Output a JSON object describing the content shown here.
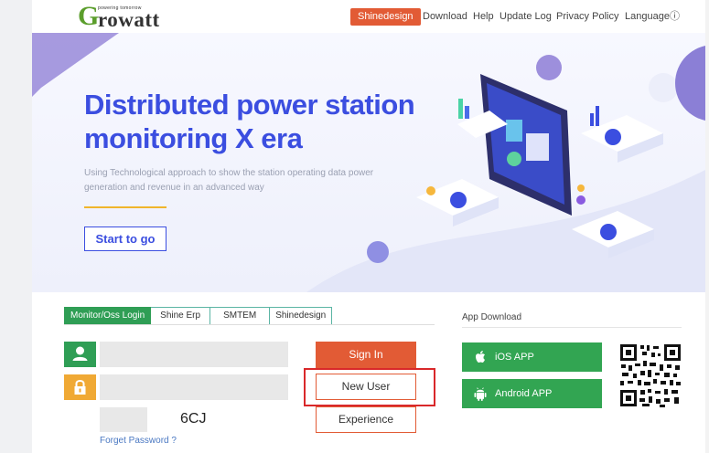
{
  "header": {
    "logo_small": "powering tomorrow",
    "logo_initial": "G",
    "logo_rest": "rowatt",
    "badge": "Shinedesign",
    "links": [
      "Download",
      "Help",
      "Update Log",
      "Privacy Policy",
      "Languageⓘ"
    ]
  },
  "hero": {
    "title": "Distributed power station monitoring X era",
    "subtitle": "Using Technological approach to show the station operating data power generation and revenue in an advanced way",
    "cta": "Start to go"
  },
  "login": {
    "tabs": [
      "Monitor/Oss Login",
      "Shine Erp",
      "SMTEM",
      "Shinedesign"
    ],
    "active_tab": 0,
    "username": "",
    "password": "",
    "captcha_input": "",
    "captcha_code": "6CJ",
    "forget": "Forget Password ?",
    "sign_in": "Sign In",
    "new_user": "New User",
    "experience": "Experience"
  },
  "app": {
    "title": "App Download",
    "ios": "iOS APP",
    "android": "Android APP"
  },
  "colors": {
    "brand_green": "#2f9e55",
    "accent_orange": "#e25b35",
    "hero_blue": "#3b4ee0",
    "lock_yellow": "#f0a934",
    "highlight_red": "#d9282a"
  },
  "icons": [
    "user-icon",
    "lock-icon",
    "apple-icon",
    "android-icon",
    "qr-code"
  ]
}
